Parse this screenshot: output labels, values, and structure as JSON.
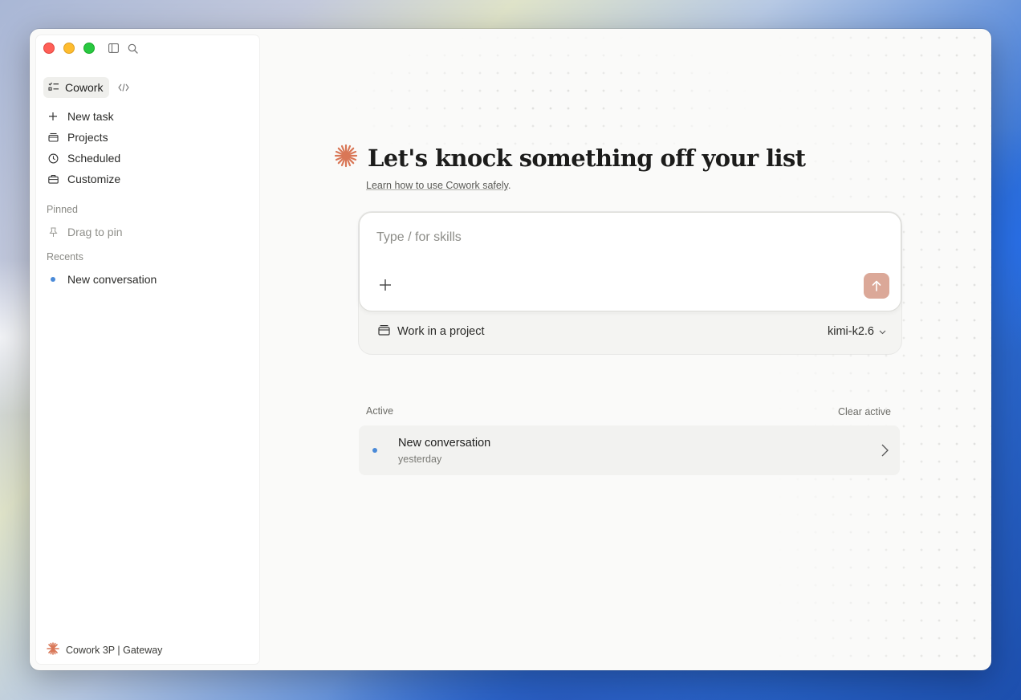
{
  "app": {
    "mode_label": "Cowork",
    "footer_label": "Cowork 3P | Gateway"
  },
  "sidebar": {
    "nav": [
      {
        "label": "New task",
        "icon": "plus-icon"
      },
      {
        "label": "Projects",
        "icon": "projects-icon"
      },
      {
        "label": "Scheduled",
        "icon": "clock-icon"
      },
      {
        "label": "Customize",
        "icon": "briefcase-icon"
      }
    ],
    "pinned_label": "Pinned",
    "pin_hint": "Drag to pin",
    "recents_label": "Recents",
    "recents": [
      {
        "label": "New conversation"
      }
    ]
  },
  "main": {
    "title": "Let's knock something off your list",
    "safety_link": "Learn how to use Cowork safely",
    "safety_suffix": ".",
    "composer": {
      "placeholder": "Type / for skills"
    },
    "project_label": "Work in a project",
    "model": "kimi-k2.6",
    "active": {
      "label": "Active",
      "clear_label": "Clear active",
      "items": [
        {
          "title": "New conversation",
          "subtitle": "yesterday"
        }
      ]
    }
  },
  "colors": {
    "accent": "#d97757",
    "send_button": "#dba898",
    "status_dot": "#4a8ad8"
  }
}
